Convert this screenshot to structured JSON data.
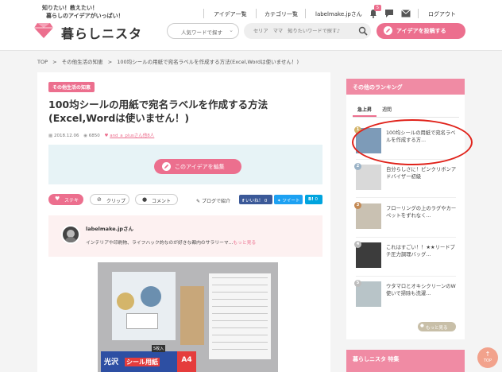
{
  "header": {
    "tagline_1": "知りたい！教えたい！",
    "tagline_2": "暮らしのアイデアがいっぱい！",
    "logo": "暮らしニスタ",
    "nav": [
      "アイデア一覧",
      "カテゴリ一覧"
    ],
    "user": "labelmake.jpさん",
    "notification_count": "5",
    "logout": "ログアウト",
    "select_label": "人気ワードで探す",
    "search_placeholder": "セリア　ママ　知りたいワードで探す♪",
    "post_button": "アイデアを投稿する"
  },
  "breadcrumb": [
    "TOP",
    "その他生活の知恵",
    "100均シールの用紙で宛名ラベルを作成する方法(Excel,Wordは使いません！)"
  ],
  "article": {
    "category": "その他生活の知恵",
    "title": "100均シールの用紙で宛名ラベルを作成する方法(Excel,Wordは使いません！)",
    "date": "2018.12.06",
    "views": "6850",
    "likes_by": "and_a_plusさん他8人",
    "edit_button": "このアイデアを編集",
    "like_button": "ステキ",
    "clip_button": "クリップ",
    "comment_button": "コメント",
    "blog_link": "ブログで紹介",
    "fb_like": "いいね！ 0",
    "tweet": "ツイート",
    "hatena": "0",
    "author_name": "labelmake.jpさん",
    "author_bio": "インテリアや印刷物、ライフハック的なのが好きな都内のサラリーマ...",
    "author_more": "もっと見る",
    "photo_label_1": "光沢",
    "photo_label_2": "シール用紙",
    "photo_label_3": "A4",
    "photo_label_4": "5枚入"
  },
  "sidebar": {
    "ranking_title": "その他のランキング",
    "tabs": [
      "急上昇",
      "週間"
    ],
    "items": [
      {
        "rank": "1",
        "title": "100均シールの用紙で宛名ラベルを作成する方..."
      },
      {
        "rank": "2",
        "title": "自分らしさに！ピンクリボンアドバイザー初級"
      },
      {
        "rank": "3",
        "title": "フローリングの上のラグやカーペットをずれなく..."
      },
      {
        "rank": "4",
        "title": "これはすごい！！★★リードプチ圧力調理バッグ..."
      },
      {
        "rank": "5",
        "title": "ウタマロとオキシクリーンのW使いで掃除も洗濯..."
      }
    ],
    "more": "もっと見る",
    "feature_title": "暮らしニスタ 特集"
  },
  "top_button": "TOP",
  "colors": {
    "accent": "#ec6f8e",
    "edit_panel": "#e7f3f6",
    "annotation": "#e0221a"
  }
}
